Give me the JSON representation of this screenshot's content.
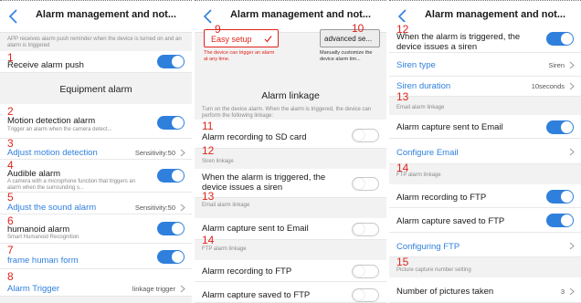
{
  "header_title": "Alarm management and not...",
  "colors": {
    "accent": "#2f7fdc",
    "annotation": "#e0231c",
    "toggle_off": "#ffffff"
  },
  "panel1": {
    "desc": "APP receives alarm push reminder when the device is turned on and an alarm is triggered",
    "receive_push": {
      "num": "1",
      "label": "Receive alarm push",
      "on": true
    },
    "section_title": "Equipment alarm",
    "motion": {
      "num": "2",
      "label": "Motion detection alarm",
      "sub": "Trigger an alarm when the camera detect...",
      "on": true
    },
    "adjust_motion": {
      "num": "3",
      "label": "Adjust motion detection",
      "value": "Sensitivity:50"
    },
    "audible": {
      "num": "4",
      "label": "Audible alarm",
      "sub": "A camera with a microphone function that triggers an alarm when the surrounding s...",
      "on": true
    },
    "adjust_sound": {
      "num": "5",
      "label": "Adjust the sound alarm",
      "value": "Sensitivity:50"
    },
    "humanoid": {
      "num": "6",
      "label": "humanoid alarm",
      "sub": "Smart Humanoid Recognition",
      "on": true
    },
    "frame_human": {
      "num": "7",
      "label": "frame human form",
      "on": true
    },
    "trigger": {
      "num": "8",
      "label": "Alarm Trigger",
      "value": "linkage trigger"
    }
  },
  "panel2": {
    "easy_num": "9",
    "easy_label": "Easy setup",
    "easy_hint": "The device can trigger an alarm at any time.",
    "adv_num": "10",
    "adv_label": "advanced se...",
    "adv_hint": "Manually customize the device alarm tim...",
    "section_title": "Alarm linkage",
    "linkage_desc": "Turn on the device alarm. When the alarm is triggered, the device can perform the following linkage:",
    "sd": {
      "num": "11",
      "label": "Alarm recording to SD card",
      "on": false
    },
    "siren_header": {
      "num": "12",
      "label": "Siren linkage"
    },
    "siren": {
      "label": "When the alarm is triggered, the device issues a siren",
      "on": false
    },
    "email_header": {
      "num": "13",
      "label": "Email alarm linkage"
    },
    "email": {
      "label": "Alarm capture sent to Email",
      "on": false
    },
    "ftp_header": {
      "num": "14",
      "label": "FTP alarm linkage"
    },
    "ftp_rec": {
      "label": "Alarm recording to FTP",
      "on": false
    },
    "ftp_cap": {
      "label": "Alarm capture saved to FTP",
      "on": false
    }
  },
  "panel3": {
    "siren": {
      "num": "12",
      "label": "When the alarm is triggered, the device issues a siren",
      "on": true
    },
    "siren_type": {
      "label": "Siren type",
      "value": "Siren"
    },
    "siren_duration": {
      "label": "Siren duration",
      "value": "10seconds"
    },
    "email_header": {
      "num": "13",
      "label": "Email alarm linkage"
    },
    "email": {
      "label": "Alarm capture sent to Email",
      "on": true
    },
    "configure_email": {
      "label": "Configure Email"
    },
    "ftp_header": {
      "num": "14",
      "label": "FTP alarm linkage"
    },
    "ftp_rec": {
      "label": "Alarm recording to FTP",
      "on": true
    },
    "ftp_cap": {
      "label": "Alarm capture saved to FTP",
      "on": true
    },
    "configure_ftp": {
      "label": "Configuring FTP"
    },
    "picture_header": {
      "num": "15",
      "label": "Picture capture number setting"
    },
    "pictures": {
      "label": "Number of pictures taken",
      "value": "3"
    }
  }
}
